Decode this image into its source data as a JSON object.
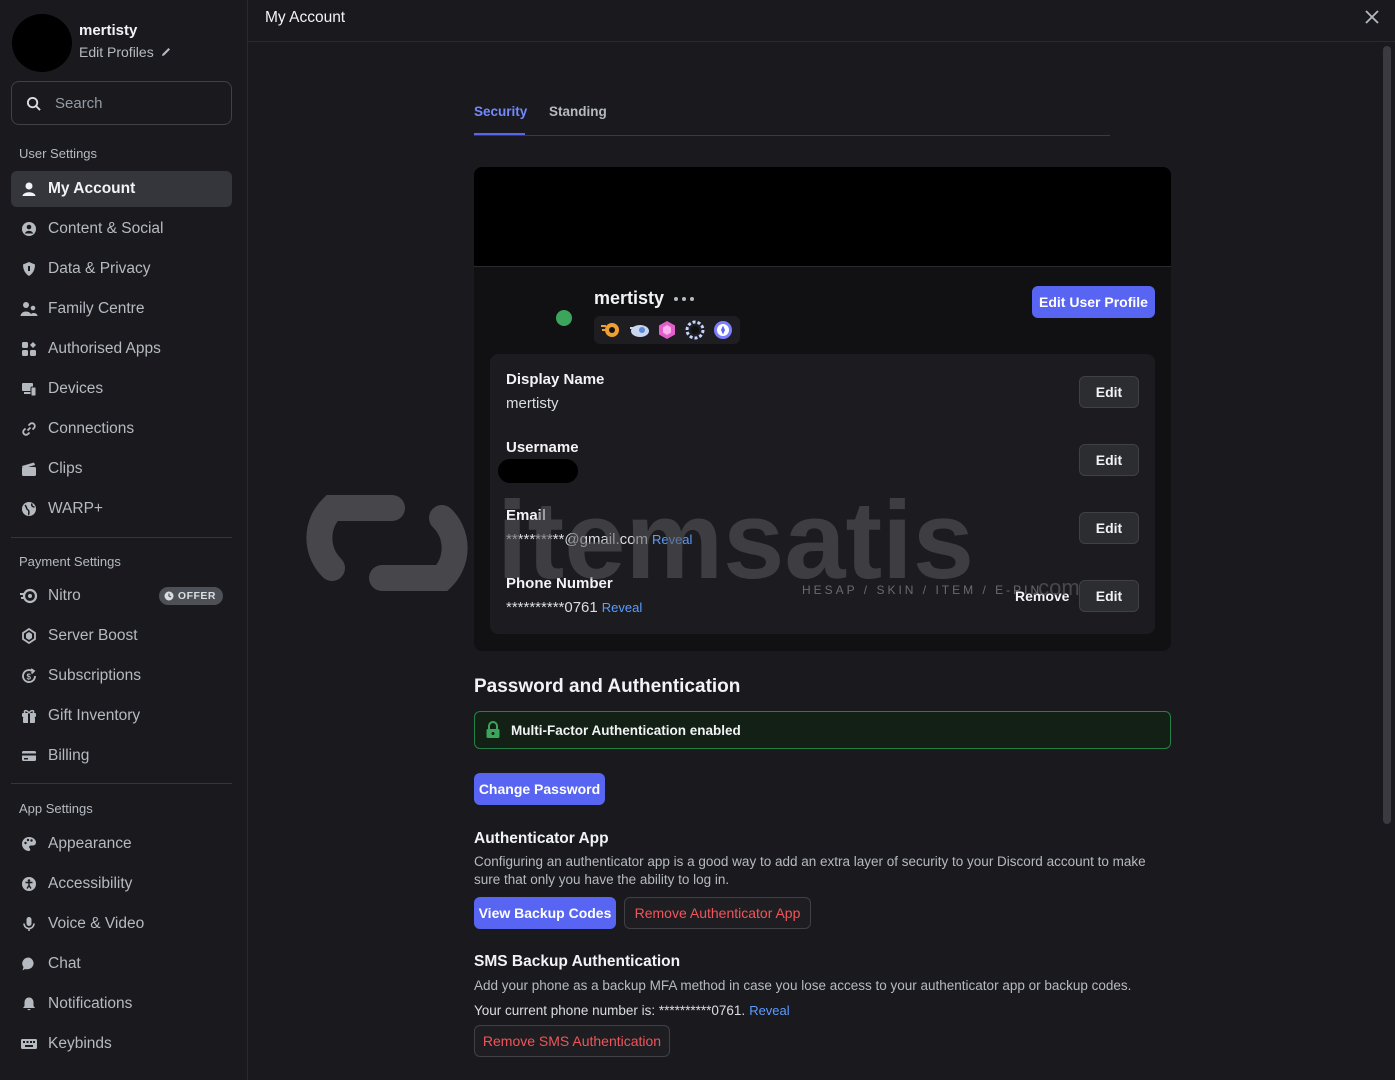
{
  "profile": {
    "name": "mertisty",
    "edit_label": "Edit Profiles"
  },
  "search": {
    "placeholder": "Search"
  },
  "sidebar": {
    "user_settings_label": "User Settings",
    "user_items": [
      {
        "label": "My Account",
        "icon": "person-icon"
      },
      {
        "label": "Content & Social",
        "icon": "content-social-icon"
      },
      {
        "label": "Data & Privacy",
        "icon": "shield-icon"
      },
      {
        "label": "Family Centre",
        "icon": "family-icon"
      },
      {
        "label": "Authorised Apps",
        "icon": "apps-icon"
      },
      {
        "label": "Devices",
        "icon": "devices-icon"
      },
      {
        "label": "Connections",
        "icon": "link-icon"
      },
      {
        "label": "Clips",
        "icon": "clapper-icon"
      },
      {
        "label": "WARP+",
        "icon": "globe-icon"
      }
    ],
    "payment_settings_label": "Payment Settings",
    "payment_items": [
      {
        "label": "Nitro",
        "icon": "nitro-icon",
        "badge": "OFFER"
      },
      {
        "label": "Server Boost",
        "icon": "boost-icon"
      },
      {
        "label": "Subscriptions",
        "icon": "subscriptions-icon"
      },
      {
        "label": "Gift Inventory",
        "icon": "gift-icon"
      },
      {
        "label": "Billing",
        "icon": "card-icon"
      }
    ],
    "app_settings_label": "App Settings",
    "app_items": [
      {
        "label": "Appearance",
        "icon": "palette-icon"
      },
      {
        "label": "Accessibility",
        "icon": "accessibility-icon"
      },
      {
        "label": "Voice & Video",
        "icon": "mic-icon"
      },
      {
        "label": "Chat",
        "icon": "chat-bubble-icon"
      },
      {
        "label": "Notifications",
        "icon": "bell-icon"
      },
      {
        "label": "Keybinds",
        "icon": "keyboard-icon"
      }
    ]
  },
  "header": {
    "title": "My Account"
  },
  "tabs": [
    {
      "label": "Security"
    },
    {
      "label": "Standing"
    }
  ],
  "card": {
    "username": "mertisty",
    "edit_profile_label": "Edit User Profile",
    "fields": {
      "display_name_label": "Display Name",
      "display_name_value": "mertisty",
      "username_label": "Username",
      "email_label": "Email",
      "email_value": "**********@gmail.com",
      "phone_label": "Phone Number",
      "phone_value": "**********0761",
      "reveal": "Reveal",
      "edit": "Edit",
      "remove": "Remove"
    }
  },
  "auth": {
    "title": "Password and Authentication",
    "mfa_status": "Multi-Factor Authentication enabled",
    "change_password": "Change Password",
    "authenticator_title": "Authenticator App",
    "authenticator_desc": "Configuring an authenticator app is a good way to add an extra layer of security to your Discord account to make sure that only you have the ability to log in.",
    "view_backup_codes": "View Backup Codes",
    "remove_authenticator": "Remove Authenticator App",
    "sms_title": "SMS Backup Authentication",
    "sms_desc": "Add your phone as a backup MFA method in case you lose access to your authenticator app or backup codes.",
    "sms_phone_prefix": "Your current phone number is: **********0761.",
    "sms_reveal": "Reveal",
    "remove_sms": "Remove SMS Authentication"
  },
  "watermark": {
    "brand": "itemsatis",
    "tagline": "HESAP / SKIN / ITEM / E-PIN",
    "domain": ".com"
  },
  "colors": {
    "accent": "#5865f2",
    "online": "#3ba55c",
    "danger": "#f0555a",
    "link": "#5b9cff"
  }
}
